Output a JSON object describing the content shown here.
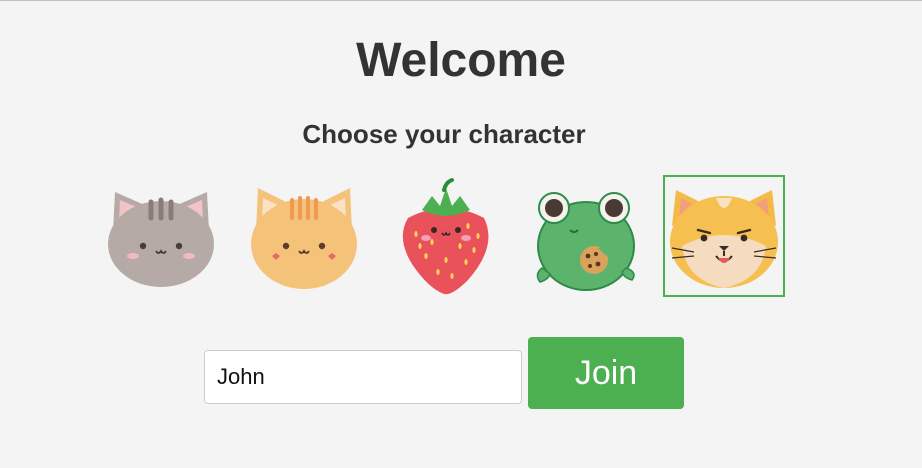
{
  "page": {
    "title": "Welcome",
    "subtitle": "Choose your character"
  },
  "characters": [
    {
      "name": "gray-cat",
      "icon": "gray-cat-icon",
      "selected": false
    },
    {
      "name": "orange-cat",
      "icon": "orange-cat-icon",
      "selected": false
    },
    {
      "name": "strawberry",
      "icon": "strawberry-icon",
      "selected": false
    },
    {
      "name": "frog",
      "icon": "frog-icon",
      "selected": false
    },
    {
      "name": "shiba-cat",
      "icon": "shiba-cat-icon",
      "selected": true
    }
  ],
  "form": {
    "name_value": "John",
    "join_label": "Join"
  },
  "colors": {
    "background": "#f4f4f4",
    "text": "#333333",
    "accent": "#4caf50",
    "button_text": "#ffffff"
  }
}
